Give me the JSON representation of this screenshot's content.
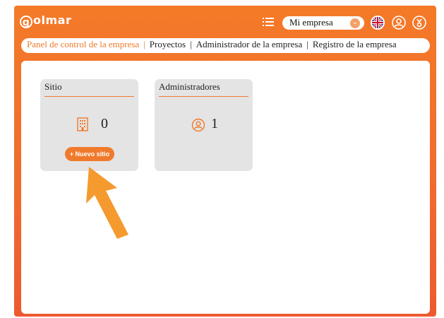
{
  "app": {
    "logo_text": "olmar",
    "logo_mark": "g"
  },
  "header": {
    "company_select": {
      "value": "Mi empresa"
    },
    "icons": [
      "menu-list-icon",
      "uk-flag-icon",
      "user-circle-icon",
      "logout-icon"
    ]
  },
  "nav": {
    "items": [
      {
        "label": "Panel de control de la empresa",
        "active": true
      },
      {
        "label": "Proyectos",
        "active": false
      },
      {
        "label": "Administrador de la empresa",
        "active": false
      },
      {
        "label": "Registro de la empresa",
        "active": false
      }
    ],
    "separator": "|"
  },
  "cards": {
    "sites": {
      "title": "Sitio",
      "count": "0",
      "icon": "building-icon",
      "button_label": "+ Nuevo sitio"
    },
    "admins": {
      "title": "Administradores",
      "count": "1",
      "icon": "user-circle-icon"
    }
  },
  "colors": {
    "accent": "#f07a2c",
    "card_bg": "#e4e4e4",
    "text": "#222222"
  }
}
